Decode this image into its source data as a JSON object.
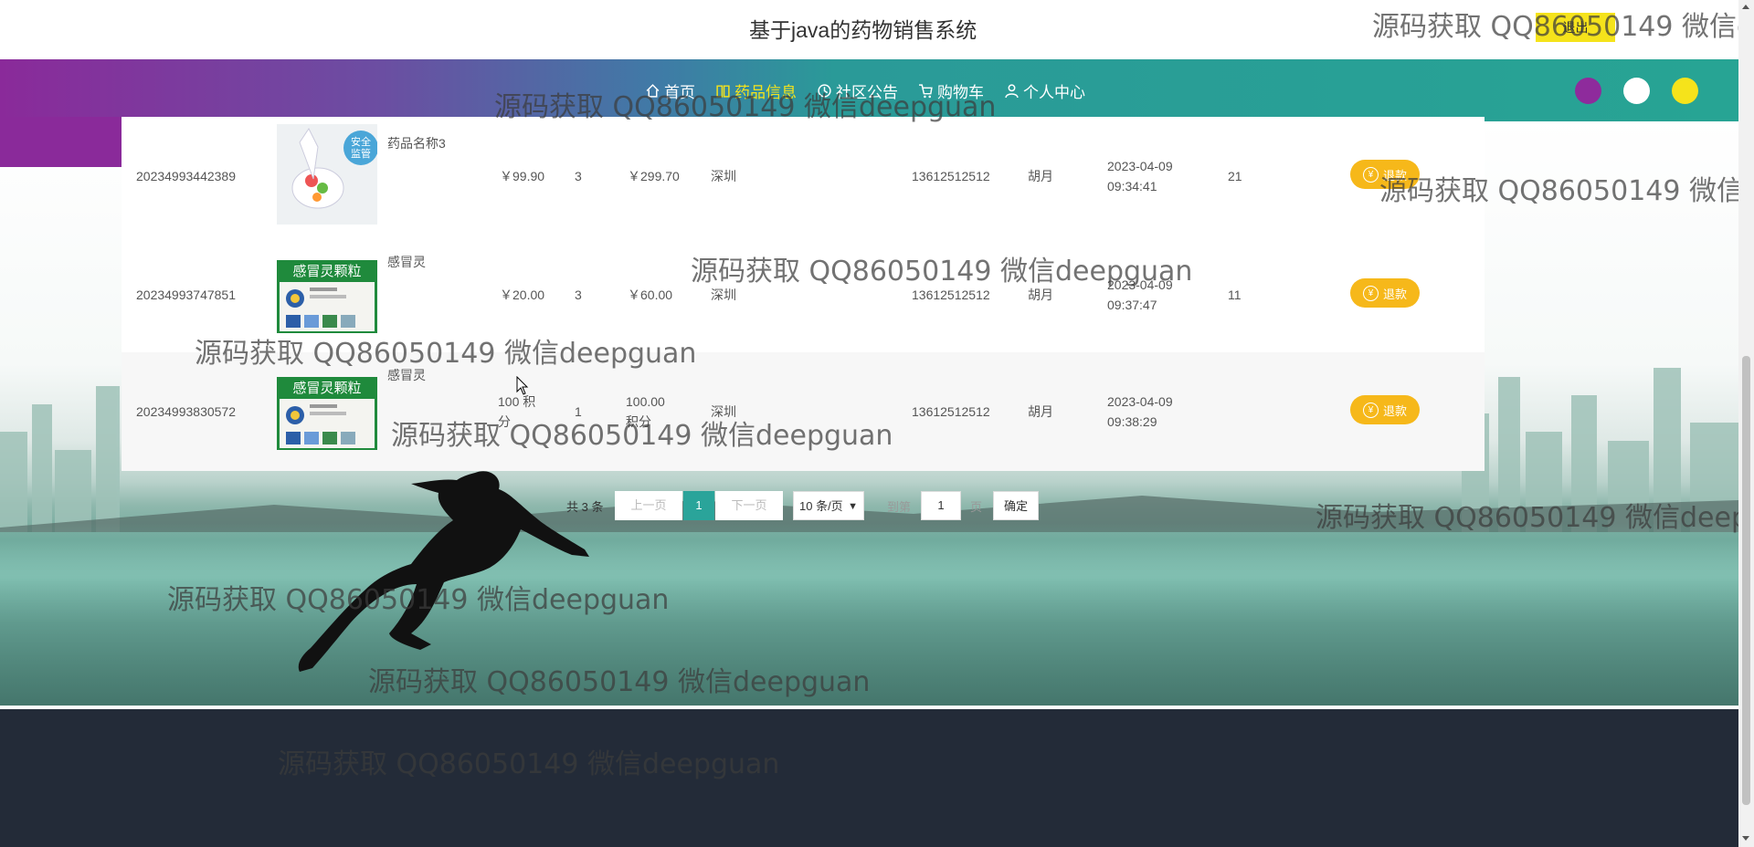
{
  "header": {
    "site_title": "基于java的药物销售系统",
    "logout_label": "退出"
  },
  "nav": {
    "items": [
      {
        "label": "首页",
        "icon": "home-icon"
      },
      {
        "label": "药品信息",
        "icon": "book-icon",
        "active": true
      },
      {
        "label": "社区公告",
        "icon": "clock-icon"
      },
      {
        "label": "购物车",
        "icon": "cart-icon"
      },
      {
        "label": "个人中心",
        "icon": "user-icon"
      }
    ],
    "theme_colors": [
      "#8e2b9c",
      "#ffffff",
      "#f5e31b"
    ]
  },
  "orders": {
    "rows": [
      {
        "order_no": "20234993442389",
        "product_name": "药品名称3",
        "thumb_text": "安全\n监管",
        "price": "￥99.90",
        "qty": "3",
        "total": "￥299.70",
        "address": "深圳",
        "phone": "13612512512",
        "name": "胡月",
        "date": "2023-04-09",
        "time": "09:34:41",
        "extra": "21",
        "action_label": "退款"
      },
      {
        "order_no": "20234993747851",
        "product_name": "感冒灵",
        "thumb_text": "感冒灵颗粒",
        "price": "￥20.00",
        "qty": "3",
        "total": "￥60.00",
        "address": "深圳",
        "phone": "13612512512",
        "name": "胡月",
        "date": "2023-04-09",
        "time": "09:37:47",
        "extra": "11",
        "action_label": "退款"
      },
      {
        "order_no": "20234993830572",
        "product_name": "感冒灵",
        "thumb_text": "感冒灵颗粒",
        "price": "100 积分",
        "qty": "1",
        "total": "100.00 积分",
        "address": "深圳",
        "phone": "13612512512",
        "name": "胡月",
        "date": "2023-04-09",
        "time": "09:38:29",
        "extra": "",
        "action_label": "退款"
      }
    ]
  },
  "pagination": {
    "total": "共 3 条",
    "prev": "上一页",
    "current": "1",
    "next": "下一页",
    "page_size": "10 条/页",
    "goto": "到第",
    "goto_value": "1",
    "page_unit": "页",
    "confirm": "确定"
  },
  "watermark": "源码获取 QQ86050149 微信deepguan"
}
